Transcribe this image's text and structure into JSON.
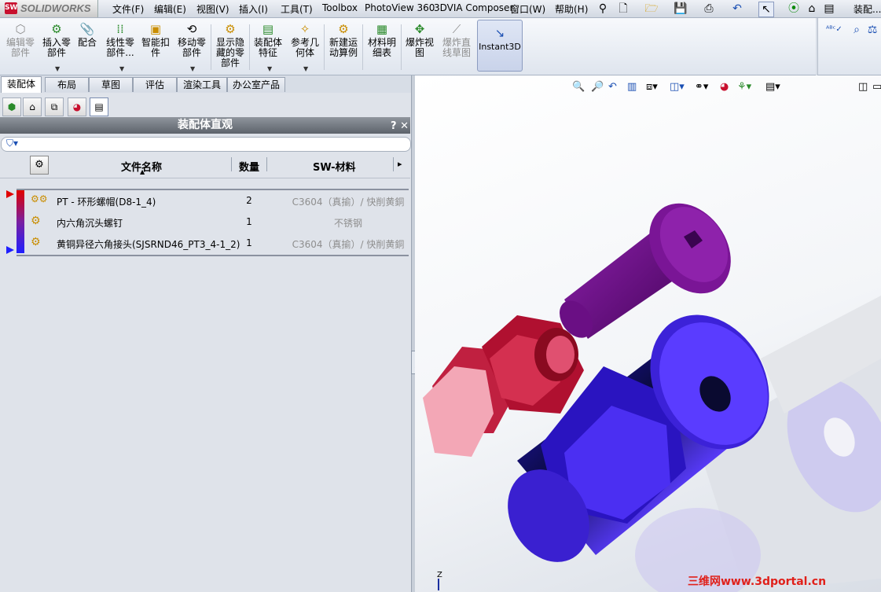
{
  "app": {
    "brand": "SOLIDWORKS",
    "title_truncated": "装配..."
  },
  "menu": [
    "文件(F)",
    "编辑(E)",
    "视图(V)",
    "插入(I)",
    "工具(T)",
    "Toolbox",
    "PhotoView 360",
    "3DVIA Composer",
    "窗口(W)",
    "帮助(H)"
  ],
  "commands": [
    {
      "label": "编辑零\n部件",
      "icon": "edit-component-icon",
      "glyph": "⬡",
      "enabled": false
    },
    {
      "label": "插入零\n部件",
      "icon": "insert-component-icon",
      "glyph": "⚙",
      "enabled": true
    },
    {
      "label": "配合",
      "icon": "mate-icon",
      "glyph": "📎",
      "enabled": true
    },
    {
      "label": "线性零\n部件...",
      "icon": "linear-pattern-icon",
      "glyph": "⁞⁞",
      "enabled": true
    },
    {
      "label": "智能扣\n件",
      "icon": "smart-fastener-icon",
      "glyph": "▣",
      "enabled": true
    },
    {
      "label": "移动零\n部件",
      "icon": "move-component-icon",
      "glyph": "⟲",
      "enabled": true
    },
    {
      "label": "显示隐\n藏的零\n部件",
      "icon": "show-hidden-icon",
      "glyph": "⚙",
      "enabled": true
    },
    {
      "label": "装配体\n特征",
      "icon": "assembly-feature-icon",
      "glyph": "▤",
      "enabled": true
    },
    {
      "label": "参考几\n何体",
      "icon": "reference-geometry-icon",
      "glyph": "✧",
      "enabled": true
    },
    {
      "label": "新建运\n动算例",
      "icon": "new-motion-study-icon",
      "glyph": "⚙",
      "enabled": true
    },
    {
      "label": "材料明\n细表",
      "icon": "bom-icon",
      "glyph": "▦",
      "enabled": true
    },
    {
      "label": "爆炸视\n图",
      "icon": "exploded-view-icon",
      "glyph": "✥",
      "enabled": true
    },
    {
      "label": "爆炸直\n线草图",
      "icon": "explode-line-sketch-icon",
      "glyph": "⟋",
      "enabled": false
    },
    {
      "label": "Instant3D",
      "icon": "instant3d-icon",
      "glyph": "↘",
      "enabled": true,
      "active": true
    }
  ],
  "tabs": [
    "装配体",
    "布局",
    "草图",
    "评估",
    "渲染工具",
    "办公室产品"
  ],
  "panel": {
    "title": "装配体直观",
    "help": "?",
    "close": "✕",
    "columns": {
      "name": "文件名称",
      "qty": "数量",
      "material": "SW-材料",
      "more": "▸"
    },
    "rows": [
      {
        "name": "PT - 环形螺帽(D8-1_4)",
        "qty": "2",
        "material": "C3604（真揄）/ 快削黄銅"
      },
      {
        "name": "内六角沉头螺钉",
        "qty": "1",
        "material": "不锈钢"
      },
      {
        "name": "黄铜异径六角接头(SJSRND46_PT3_4-1_2)",
        "qty": "1",
        "material": "C3604（真揄）/ 快削黄銅"
      }
    ],
    "marker_colors": {
      "top": "#e00000",
      "bottom": "#1f1fff"
    }
  },
  "viewport": {
    "triad_label": "Z",
    "watermark": "三维网www.3dportal.cn"
  }
}
